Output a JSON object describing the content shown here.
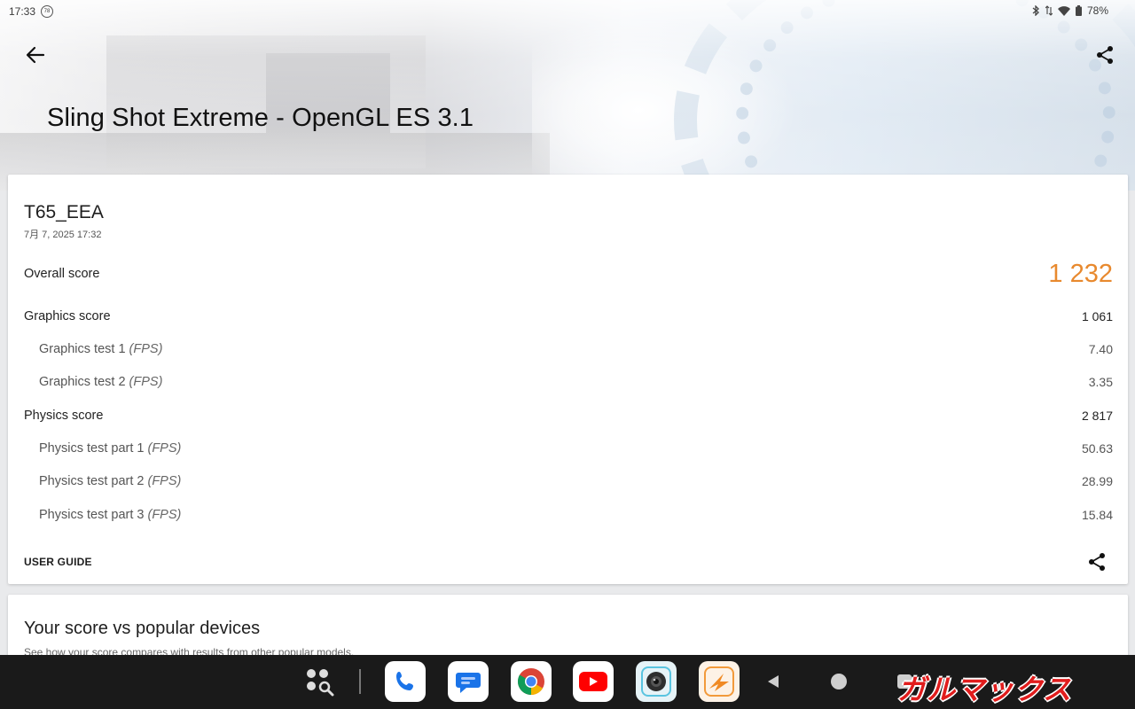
{
  "status_bar": {
    "time": "17:33",
    "notification_badge": "78",
    "battery_percent": "78%"
  },
  "header": {
    "title": "Sling Shot Extreme - OpenGL ES 3.1"
  },
  "result": {
    "device_name": "T65_EEA",
    "date": "7月 7, 2025 17:32",
    "overall_label": "Overall score",
    "overall_value": "1 232",
    "graphics_label": "Graphics score",
    "graphics_value": "1 061",
    "graphics_tests": [
      {
        "label": "Graphics test 1",
        "unit": "(FPS)",
        "value": "7.40"
      },
      {
        "label": "Graphics test 2",
        "unit": "(FPS)",
        "value": "3.35"
      }
    ],
    "physics_label": "Physics score",
    "physics_value": "2 817",
    "physics_tests": [
      {
        "label": "Physics test part 1",
        "unit": "(FPS)",
        "value": "50.63"
      },
      {
        "label": "Physics test part 2",
        "unit": "(FPS)",
        "value": "28.99"
      },
      {
        "label": "Physics test part 3",
        "unit": "(FPS)",
        "value": "15.84"
      }
    ],
    "user_guide_label": "USER GUIDE"
  },
  "compare": {
    "heading": "Your score vs popular devices",
    "subtitle": "See how your score compares with results from other popular models."
  },
  "taskbar": {
    "apps": [
      "app-drawer",
      "phone",
      "messages",
      "chrome",
      "youtube",
      "camera",
      "3dmark"
    ]
  },
  "watermark": "ガルマックス",
  "colors": {
    "accent_score": "#e8892e",
    "taskbar_bg": "#1a1a1a",
    "watermark": "#e11d1d"
  }
}
